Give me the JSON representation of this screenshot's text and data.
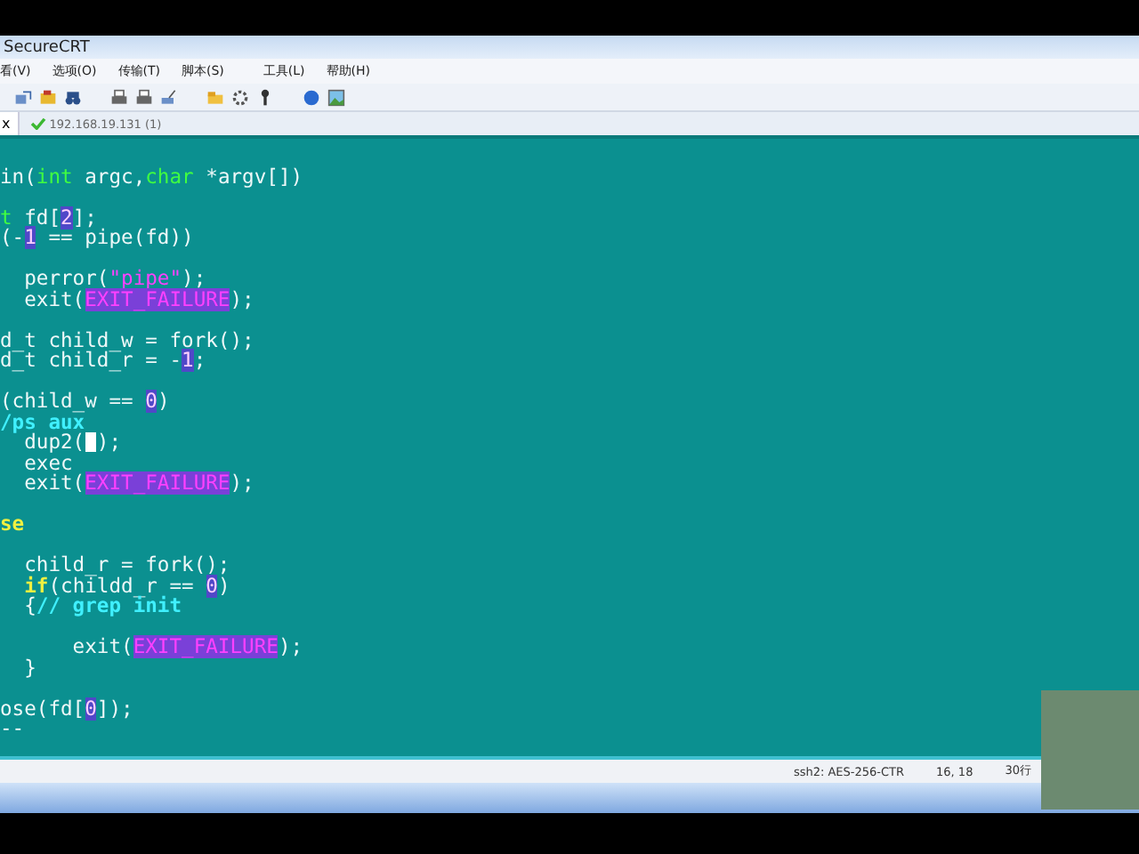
{
  "window": {
    "title": "SecureCRT"
  },
  "menu": [
    "看(V)",
    "选项(O)",
    "传输(T)",
    "脚本(S)",
    "工具(L)",
    "帮助(H)"
  ],
  "tabs": [
    {
      "close": "x",
      "label": "192.168.19.131 (1)",
      "connected": true
    }
  ],
  "terminal": {
    "lines": [
      {
        "blank_before": true,
        "segments": [
          {
            "kind": "plain",
            "text": "in("
          },
          {
            "kind": "type",
            "text": "int"
          },
          {
            "kind": "plain",
            "text": " argc,"
          },
          {
            "kind": "type",
            "text": "char"
          },
          {
            "kind": "plain",
            "text": " *argv[])"
          }
        ]
      },
      {
        "blank_before": true,
        "segments": [
          {
            "kind": "type",
            "text": "t"
          },
          {
            "kind": "plain",
            "text": " fd["
          },
          {
            "kind": "number",
            "text": "2"
          },
          {
            "kind": "plain",
            "text": "];"
          }
        ]
      },
      {
        "blank_before": false,
        "segments": [
          {
            "kind": "plain",
            "text": "(-"
          },
          {
            "kind": "number",
            "text": "1"
          },
          {
            "kind": "plain",
            "text": " == pipe(fd))"
          }
        ]
      },
      {
        "blank_before": true,
        "segments": [
          {
            "kind": "plain",
            "text": "  perror("
          },
          {
            "kind": "string",
            "text": "\"pipe\""
          },
          {
            "kind": "plain",
            "text": ");"
          }
        ]
      },
      {
        "blank_before": false,
        "segments": [
          {
            "kind": "plain",
            "text": "  exit("
          },
          {
            "kind": "constant",
            "text": "EXIT_FAILURE"
          },
          {
            "kind": "plain",
            "text": ");"
          }
        ]
      },
      {
        "blank_before": true,
        "segments": [
          {
            "kind": "plain",
            "text": "d_t child_w = fork();"
          }
        ]
      },
      {
        "blank_before": false,
        "segments": [
          {
            "kind": "plain",
            "text": "d_t child_r = -"
          },
          {
            "kind": "number",
            "text": "1"
          },
          {
            "kind": "plain",
            "text": ";"
          }
        ]
      },
      {
        "blank_before": true,
        "segments": [
          {
            "kind": "plain",
            "text": "(child_w == "
          },
          {
            "kind": "number",
            "text": "0"
          },
          {
            "kind": "plain",
            "text": ")"
          }
        ]
      },
      {
        "blank_before": false,
        "segments": [
          {
            "kind": "comment",
            "text": "/ps aux"
          }
        ]
      },
      {
        "blank_before": false,
        "segments": [
          {
            "kind": "plain",
            "text": "  dup2("
          },
          {
            "kind": "cursor"
          },
          {
            "kind": "plain",
            "text": ");"
          }
        ]
      },
      {
        "blank_before": false,
        "segments": [
          {
            "kind": "plain",
            "text": "  exec"
          }
        ]
      },
      {
        "blank_before": false,
        "segments": [
          {
            "kind": "plain",
            "text": "  exit("
          },
          {
            "kind": "constant",
            "text": "EXIT_FAILURE"
          },
          {
            "kind": "plain",
            "text": ");"
          }
        ]
      },
      {
        "blank_before": true,
        "segments": [
          {
            "kind": "keyword",
            "text": "se"
          }
        ]
      },
      {
        "blank_before": true,
        "segments": [
          {
            "kind": "plain",
            "text": "  child_r = fork();"
          }
        ]
      },
      {
        "blank_before": false,
        "segments": [
          {
            "kind": "keyword",
            "text": "  if"
          },
          {
            "kind": "plain",
            "text": "(childd_r == "
          },
          {
            "kind": "number",
            "text": "0"
          },
          {
            "kind": "plain",
            "text": ")"
          }
        ]
      },
      {
        "blank_before": false,
        "segments": [
          {
            "kind": "plain",
            "text": "  {"
          },
          {
            "kind": "comment",
            "text": "// grep init"
          }
        ]
      },
      {
        "blank_before": true,
        "segments": [
          {
            "kind": "plain",
            "text": "      exit("
          },
          {
            "kind": "constant",
            "text": "EXIT_FAILURE"
          },
          {
            "kind": "plain",
            "text": ");"
          }
        ]
      },
      {
        "blank_before": false,
        "segments": [
          {
            "kind": "plain",
            "text": "  }"
          }
        ]
      },
      {
        "blank_before": true,
        "segments": [
          {
            "kind": "plain",
            "text": "ose(fd["
          },
          {
            "kind": "number",
            "text": "0"
          },
          {
            "kind": "plain",
            "text": "]);"
          }
        ]
      },
      {
        "blank_before": false,
        "segments": [
          {
            "kind": "plain",
            "text": "--"
          }
        ]
      }
    ]
  },
  "status_bar": [
    "ssh2: AES-256-CTR",
    "16, 18",
    "30行"
  ]
}
